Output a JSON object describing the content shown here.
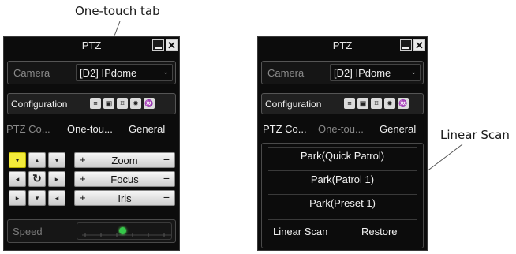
{
  "callouts": {
    "one_touch_tab": "One-touch tab",
    "linear_scan": "Linear Scan"
  },
  "left_panel": {
    "title": "PTZ",
    "camera_label": "Camera",
    "camera_value": "[D2] IPdome",
    "configuration_label": "Configuration",
    "tabs": [
      "PTZ Co...",
      "One-tou...",
      "General"
    ],
    "direction_pad": [
      "▾",
      "▴",
      "▾",
      "◂",
      "↻",
      "▸",
      "▸",
      "▾",
      "◂"
    ],
    "controls": [
      {
        "plus": "+",
        "name": "Zoom",
        "minus": "−"
      },
      {
        "plus": "+",
        "name": "Focus",
        "minus": "−"
      },
      {
        "plus": "+",
        "name": "Iris",
        "minus": "−"
      }
    ],
    "speed_label": "Speed",
    "speed_level": 0.48
  },
  "right_panel": {
    "title": "PTZ",
    "camera_label": "Camera",
    "camera_value": "[D2] IPdome",
    "configuration_label": "Configuration",
    "tabs": [
      "PTZ Co...",
      "One-tou...",
      "General"
    ],
    "one_touch_items": [
      "Park(Quick Patrol)",
      "Park(Patrol 1)",
      "Park(Preset 1)"
    ],
    "linear_scan_label": "Linear Scan",
    "restore_label": "Restore"
  },
  "icons": [
    "window-minimize-icon",
    "window-close-icon",
    "menu-icon",
    "preset-icon",
    "focus-frame-icon",
    "light-icon",
    "wiper-icon",
    "dropdown-chevron-icon",
    "speed-slider-knob"
  ],
  "colors": {
    "panel_bg": "#0c0c0c",
    "active_direction": "#f4ec3a",
    "speed_knob": "#35c84a"
  }
}
